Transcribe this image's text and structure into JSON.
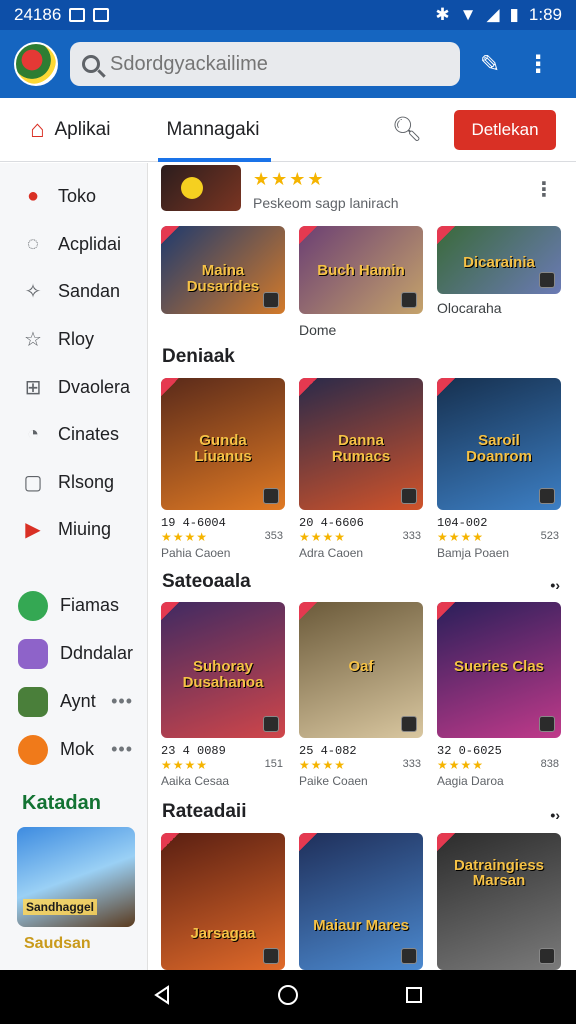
{
  "status_bar": {
    "left_text": "24186",
    "time": "1:89"
  },
  "search": {
    "placeholder": "Sdordgyackailime"
  },
  "tabs": {
    "home_label": "Aplikai",
    "manage_label": "Mannagaki",
    "update_button": "Detlekan"
  },
  "sidebar": {
    "items": [
      {
        "label": "Toko",
        "icon": "shop-icon"
      },
      {
        "label": "Acplidai",
        "icon": "chat-icon"
      },
      {
        "label": "Sandan",
        "icon": "puzzle-icon"
      },
      {
        "label": "Rloy",
        "icon": "star-icon"
      },
      {
        "label": "Dvaolera",
        "icon": "gamepad-icon"
      },
      {
        "label": "Cinates",
        "icon": "speech-icon"
      },
      {
        "label": "Rlsong",
        "icon": "bookmark-icon"
      },
      {
        "label": "Miuing",
        "icon": "youtube-icon"
      }
    ],
    "apps": [
      {
        "label": "Fiamas",
        "color": "#34a853"
      },
      {
        "label": "Ddndalar",
        "color": "#8e63c9"
      },
      {
        "label": "Aynt",
        "color": "#4a7f3a"
      },
      {
        "label": "Mok",
        "color": "#f07a1a"
      }
    ],
    "section_title": "Katadan",
    "banner_text": "Sandhaggel",
    "banner_caption": "Saudsan"
  },
  "top_item": {
    "stars": "★★★★",
    "subtitle": "Peskeom sagp lanirach"
  },
  "row1": [
    {
      "art": "Maina Dusarides",
      "caption": "",
      "colors": [
        "#1e3a6e",
        "#d37a2a"
      ]
    },
    {
      "art": "Buch Hamin",
      "caption": "Dome",
      "colors": [
        "#6b3f73",
        "#c5a36b"
      ]
    },
    {
      "art": "Dicarainia",
      "caption": "Olocaraha",
      "colors": [
        "#3a6a3a",
        "#6b7ab5"
      ]
    }
  ],
  "sections": [
    {
      "title": "Deniaak",
      "games": [
        {
          "art": "Gunda Liuanus",
          "id": "19 4-6004",
          "stars": "★★★★",
          "name": "Pahia Caoen",
          "size": "353",
          "colors": [
            "#5a2a1a",
            "#e07a24"
          ]
        },
        {
          "art": "Danna Rumacs",
          "id": "20 4-6606",
          "stars": "★★★★",
          "name": "Adra Caoen",
          "size": "333",
          "colors": [
            "#2a2a4a",
            "#d0532a"
          ]
        },
        {
          "art": "Saroil Doanrom",
          "id": "104-002",
          "stars": "★★★★",
          "name": "Bamja Poaen",
          "size": "523",
          "colors": [
            "#16304f",
            "#3d7fc4"
          ]
        }
      ]
    },
    {
      "title": "Sateoaala",
      "games": [
        {
          "art": "Suhoray Dusahanoa",
          "id": "23 4 0089",
          "stars": "★★★★",
          "name": "Aaika Cesaa",
          "size": "151",
          "colors": [
            "#402a62",
            "#d0464a"
          ]
        },
        {
          "art": "Oaf",
          "id": "25 4-082",
          "stars": "★★★★",
          "name": "Paike Coaen",
          "size": "333",
          "colors": [
            "#6b5a3a",
            "#d9c7a0"
          ]
        },
        {
          "art": "Sueries Clas",
          "id": "32 0-6025",
          "stars": "★★★★",
          "name": "Aagia Daroa",
          "size": "838",
          "colors": [
            "#2a1f5a",
            "#c03a8a"
          ]
        }
      ]
    },
    {
      "title": "Rateadaii",
      "games": [
        {
          "art": "Jarsagaa",
          "colors": [
            "#5a1f12",
            "#e06a2a"
          ]
        },
        {
          "art": "Maiaur Mares",
          "colors": [
            "#1f2f5a",
            "#4c8ad0"
          ]
        },
        {
          "art": "Datraingiess Marsan",
          "colors": [
            "#2c2c2c",
            "#7a7a7a"
          ]
        }
      ]
    }
  ]
}
